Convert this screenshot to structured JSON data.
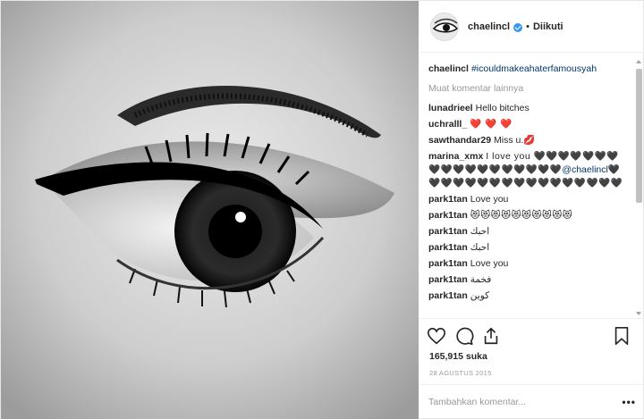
{
  "post": {
    "author": "chaelincl",
    "verified": true,
    "separator": "•",
    "follow_status": "Diikuti"
  },
  "caption": {
    "user": "chaelincl",
    "text": "#icouldmakeahaterfamousyah"
  },
  "load_more": "Muat komentar lainnya",
  "comments": [
    {
      "user": "lunadrieel",
      "text": "Hello bitches"
    },
    {
      "user": "uchralll_",
      "text": "❤️ ❤️ ❤️"
    },
    {
      "user": "sawthandar29",
      "text": "Miss u.💋"
    },
    {
      "user": "marina_xmx",
      "text": "I love you 🖤🖤🖤🖤🖤🖤🖤🖤🖤🖤🖤🖤🖤🖤🖤🖤🖤🖤",
      "mention": "@chaelincl",
      "text_after": "🖤🖤🖤🖤🖤🖤🖤🖤🖤🖤🖤🖤🖤🖤🖤🖤🖤"
    },
    {
      "user": "park1tan",
      "text": "Love you"
    },
    {
      "user": "park1tan",
      "text": "😻😻😻😻😻😻😻😻😻😻"
    },
    {
      "user": "park1tan",
      "text": "احبك",
      "rtl": true
    },
    {
      "user": "park1tan",
      "text": "احبك",
      "rtl": true
    },
    {
      "user": "park1tan",
      "text": "Love you"
    },
    {
      "user": "park1tan",
      "text": "فخمة",
      "rtl": true
    },
    {
      "user": "park1tan",
      "text": "كوين",
      "rtl": true
    }
  ],
  "likes": "165,915 suka",
  "date": "28 AGUSTUS 2015",
  "add_comment_placeholder": "Tambahkan komentar...",
  "more_options": "•••",
  "icons": {
    "like": "heart-icon",
    "comment": "comment-icon",
    "share": "share-icon",
    "save": "bookmark-icon"
  },
  "colors": {
    "verified": "#3897f0",
    "hashtag": "#003569",
    "muted": "#999999"
  }
}
